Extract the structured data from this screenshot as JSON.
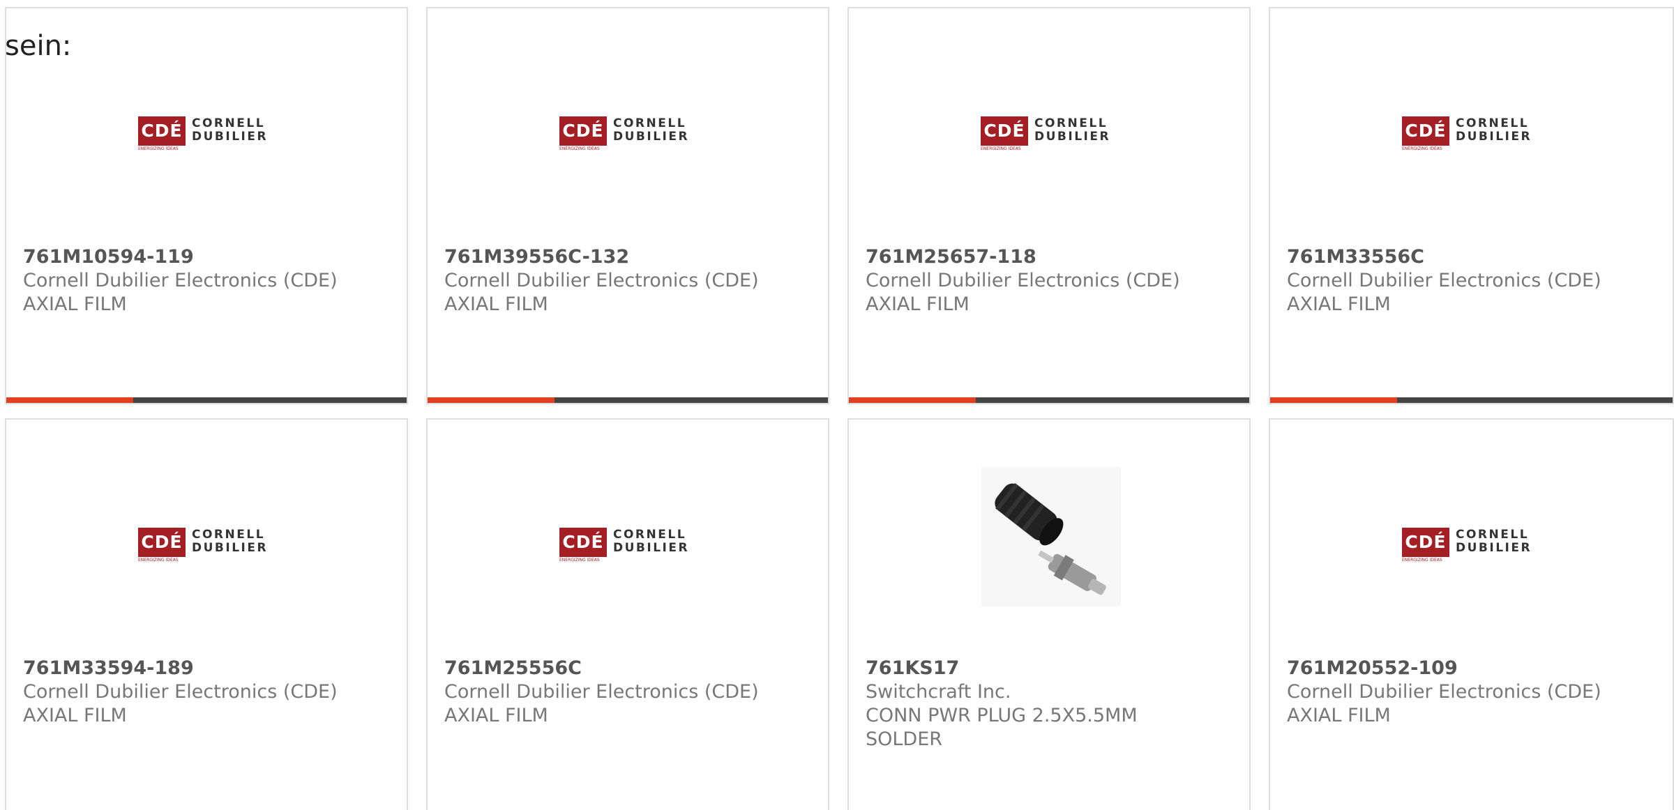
{
  "intro_text": "sein:",
  "colors": {
    "accent": "#e0401f",
    "bar_dark": "#444444",
    "cde_red": "#a31f24"
  },
  "logo": {
    "cde_letters": "CDÉ",
    "word1": "CORNELL",
    "word2": "DUBILIER",
    "tagline": "ENERGIZING IDEAS"
  },
  "products": [
    {
      "part": "761M10594-119",
      "manufacturer": "Cornell Dubilier Electronics (CDE)",
      "description": "AXIAL FILM",
      "image": "cde-logo"
    },
    {
      "part": "761M39556C-132",
      "manufacturer": "Cornell Dubilier Electronics (CDE)",
      "description": "AXIAL FILM",
      "image": "cde-logo"
    },
    {
      "part": "761M25657-118",
      "manufacturer": "Cornell Dubilier Electronics (CDE)",
      "description": "AXIAL FILM",
      "image": "cde-logo"
    },
    {
      "part": "761M33556C",
      "manufacturer": "Cornell Dubilier Electronics (CDE)",
      "description": "AXIAL FILM",
      "image": "cde-logo"
    },
    {
      "part": "761M33594-189",
      "manufacturer": "Cornell Dubilier Electronics (CDE)",
      "description": "AXIAL FILM",
      "image": "cde-logo"
    },
    {
      "part": "761M25556C",
      "manufacturer": "Cornell Dubilier Electronics (CDE)",
      "description": "AXIAL FILM",
      "image": "cde-logo"
    },
    {
      "part": "761KS17",
      "manufacturer": "Switchcraft Inc.",
      "description": "CONN PWR PLUG 2.5X5.5MM SOLDER",
      "image": "power-plug-photo"
    },
    {
      "part": "761M20552-109",
      "manufacturer": "Cornell Dubilier Electronics (CDE)",
      "description": "AXIAL FILM",
      "image": "cde-logo"
    }
  ]
}
